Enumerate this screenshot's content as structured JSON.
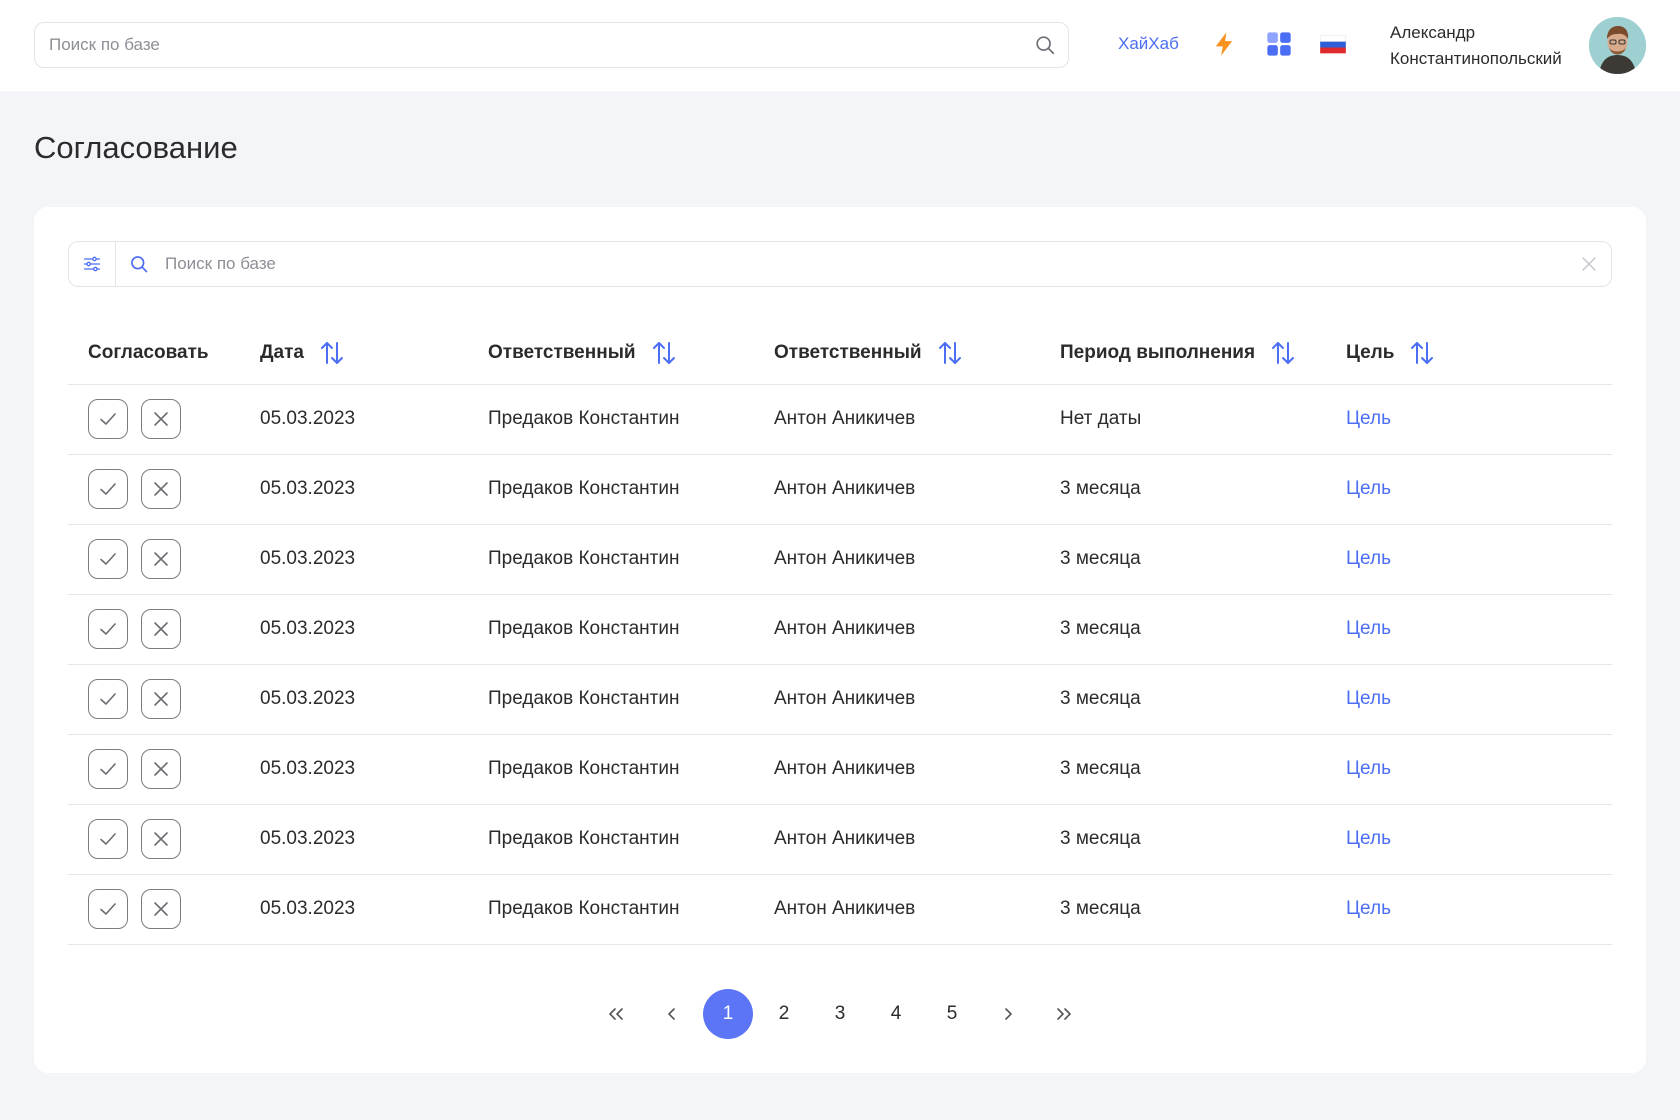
{
  "header": {
    "search_placeholder": "Поиск по базе",
    "brand_link": "ХайХаб",
    "user": {
      "first_name": "Александр",
      "last_name": "Константинопольский"
    },
    "icons": [
      "lightning-icon",
      "apps-grid-icon",
      "russia-flag-icon"
    ],
    "accent_color": "#4c6ef5",
    "lightning_color": "#f7931e"
  },
  "page": {
    "title": "Согласование"
  },
  "table_search": {
    "placeholder": "Поиск по базе"
  },
  "table": {
    "columns": [
      "Согласовать",
      "Дата",
      "Ответственный",
      "Ответственный",
      "Период выполнения",
      "Цель"
    ],
    "rows": [
      {
        "date": "05.03.2023",
        "responsible1": "Предаков Константин",
        "responsible2": "Антон Аникичев",
        "period": "Нет даты",
        "goal": "Цель"
      },
      {
        "date": "05.03.2023",
        "responsible1": "Предаков Константин",
        "responsible2": "Антон Аникичев",
        "period": "3 месяца",
        "goal": "Цель"
      },
      {
        "date": "05.03.2023",
        "responsible1": "Предаков Константин",
        "responsible2": "Антон Аникичев",
        "period": "3 месяца",
        "goal": "Цель"
      },
      {
        "date": "05.03.2023",
        "responsible1": "Предаков Константин",
        "responsible2": "Антон Аникичев",
        "period": "3 месяца",
        "goal": "Цель"
      },
      {
        "date": "05.03.2023",
        "responsible1": "Предаков Константин",
        "responsible2": "Антон Аникичев",
        "period": "3 месяца",
        "goal": "Цель"
      },
      {
        "date": "05.03.2023",
        "responsible1": "Предаков Константин",
        "responsible2": "Антон Аникичев",
        "period": "3 месяца",
        "goal": "Цель"
      },
      {
        "date": "05.03.2023",
        "responsible1": "Предаков Константин",
        "responsible2": "Антон Аникичев",
        "period": "3 месяца",
        "goal": "Цель"
      },
      {
        "date": "05.03.2023",
        "responsible1": "Предаков Константин",
        "responsible2": "Антон Аникичев",
        "period": "3 месяца",
        "goal": "Цель"
      }
    ]
  },
  "pagination": {
    "pages": [
      "1",
      "2",
      "3",
      "4",
      "5"
    ],
    "current": "1",
    "active_color": "#5b75f6"
  }
}
